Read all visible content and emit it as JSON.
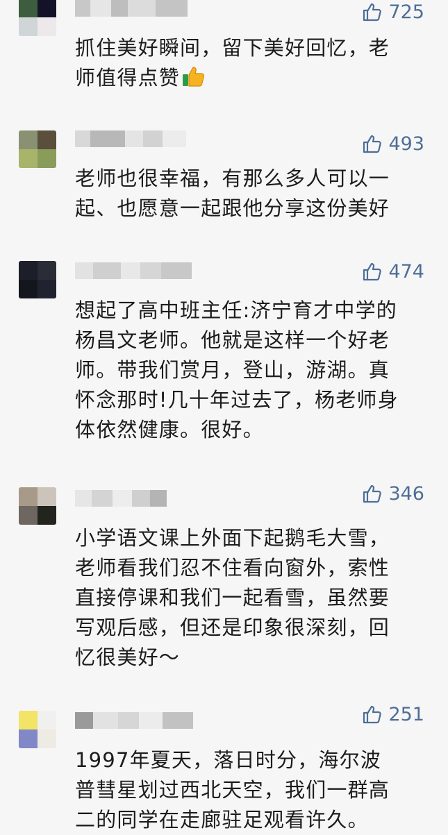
{
  "comments": [
    {
      "avatar_colors": [
        "#3c5e3e",
        "#141228",
        "#d0d6d8",
        "#ede8ea"
      ],
      "name_blocks": [
        "#c8c8c8",
        "#e6e6e6",
        "#bdbdbd",
        "#dcdcdc",
        "#c4c4c4"
      ],
      "likes": "725",
      "text": "抓住美好瞬间，留下美好回忆，老\n师值得点赞",
      "emoji": "thumbs-up"
    },
    {
      "avatar_colors": [
        "#8a9072",
        "#5a4e3c",
        "#a8b46a",
        "#8a9c5a"
      ],
      "name_blocks": [
        "#d8d8d8",
        "#b8b8b8",
        "#e4e4e4",
        "#d2d2d2",
        "#ececec"
      ],
      "likes": "493",
      "text": "老师也很幸福，有那么多人可以一\n起、也愿意一起跟他分享这份美好"
    },
    {
      "avatar_colors": [
        "#1c1e2a",
        "#2a2c36",
        "#14161e",
        "#202230"
      ],
      "name_blocks": [
        "#e2e2e2",
        "#cfcfcf",
        "#e8e8e8",
        "#d6d6d6",
        "#c8c8c8"
      ],
      "likes": "474",
      "text": "想起了高中班主任:济宁育才中学的\n杨昌文老师。他就是这样一个好老\n师。带我们赏月，登山，游湖。真\n怀念那时!几十年过去了，杨老师身\n体依然健康。很好。"
    },
    {
      "avatar_colors": [
        "#a89a88",
        "#ccc4ba",
        "#6e6660",
        "#22241e"
      ],
      "name_blocks": [
        "#e6e6e6",
        "#d4d4d4",
        "#ededed",
        "#cfcfcf",
        "#b4b4b4"
      ],
      "likes": "346",
      "text": "小学语文课上外面下起鹅毛大雪，\n老师看我们忍不住看向窗外，索性\n直接停课和我们一起看雪，虽然要\n写观后感，但还是印象很深刻，回\n忆很美好～"
    },
    {
      "avatar_colors": [
        "#f2e466",
        "#f0f0ee",
        "#8088c8",
        "#eeeae4"
      ],
      "name_blocks": [
        "#9a9a9a",
        "#e2e2e2",
        "#d6d6d6",
        "#ececec",
        "#c2c2c2"
      ],
      "likes": "251",
      "text": "1997年夏天，落日时分，海尔波\n普彗星划过西北天空，我们一群高\n二的同学在走廊驻足观看许久。"
    }
  ]
}
